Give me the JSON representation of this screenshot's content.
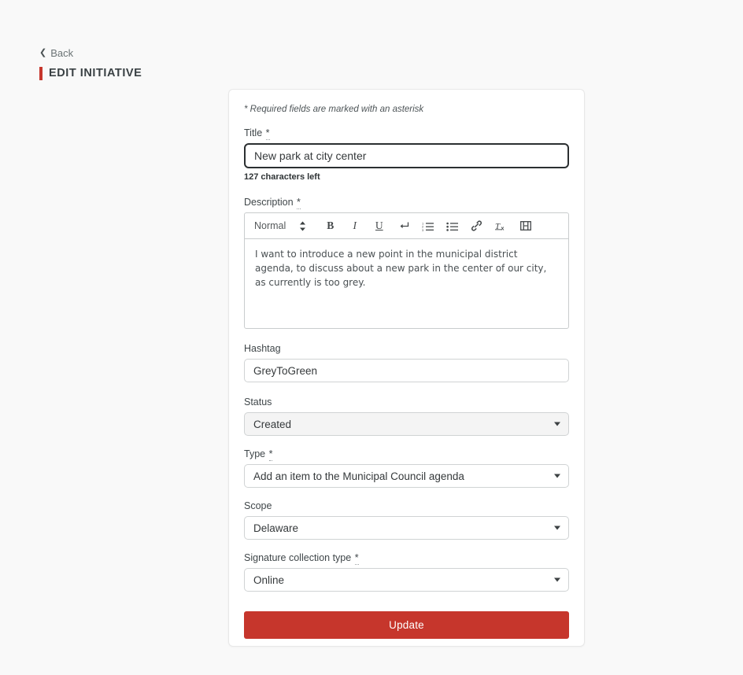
{
  "header": {
    "back_label": "Back",
    "back_icon": "chevron-left-icon",
    "page_title": "EDIT INITIATIVE",
    "accent_color": "#c6362c"
  },
  "form": {
    "required_note": "* Required fields are marked with an asterisk",
    "required_marker": "*",
    "title": {
      "label": "Title",
      "value": "New park at city center",
      "help": "127 characters left"
    },
    "description": {
      "label": "Description",
      "toolbar": {
        "format_label": "Normal",
        "stepper_icon": "up-down-stepper-icon",
        "buttons": [
          {
            "name": "bold-icon",
            "glyph": "B"
          },
          {
            "name": "italic-icon",
            "glyph": "I"
          },
          {
            "name": "underline-icon",
            "glyph": "U"
          },
          {
            "name": "line-break-icon",
            "glyph": "↵"
          },
          {
            "name": "ordered-list-icon",
            "glyph": ""
          },
          {
            "name": "bullet-list-icon",
            "glyph": ""
          },
          {
            "name": "link-icon",
            "glyph": ""
          },
          {
            "name": "clear-format-icon",
            "glyph": ""
          },
          {
            "name": "video-embed-icon",
            "glyph": ""
          }
        ]
      },
      "body": "I want to introduce a new point in the municipal district agenda, to discuss about a new park in the center of our city, as currently is too grey."
    },
    "hashtag": {
      "label": "Hashtag",
      "value": "GreyToGreen"
    },
    "status": {
      "label": "Status",
      "value": "Created",
      "options": [
        "Created"
      ]
    },
    "type": {
      "label": "Type",
      "value": "Add an item to the Municipal Council agenda",
      "options": [
        "Add an item to the Municipal Council agenda"
      ]
    },
    "scope": {
      "label": "Scope",
      "value": "Delaware",
      "options": [
        "Delaware"
      ]
    },
    "signature_type": {
      "label": "Signature collection type",
      "value": "Online",
      "options": [
        "Online"
      ]
    },
    "submit_label": "Update"
  }
}
